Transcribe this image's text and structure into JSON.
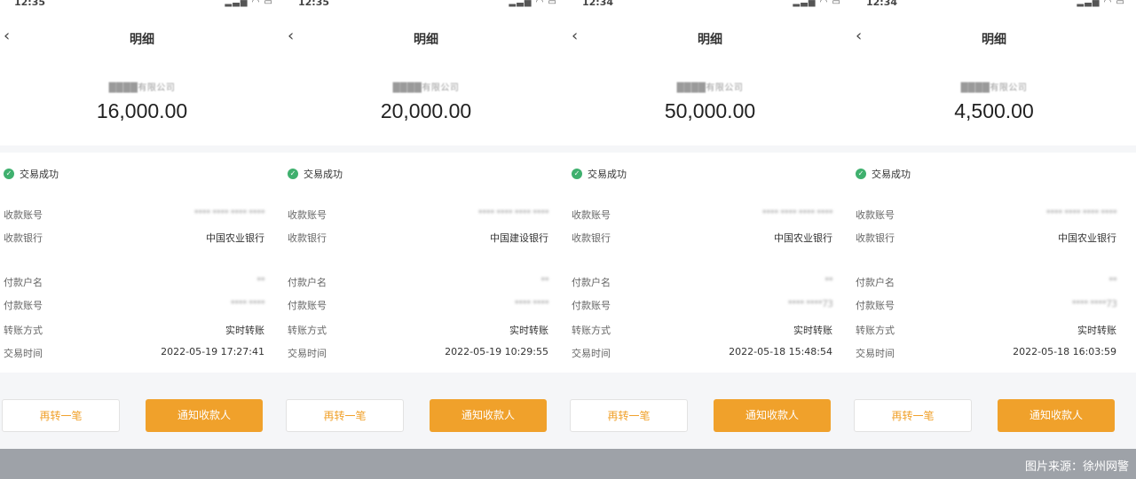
{
  "nav_title": "明细",
  "status_text": "交易成功",
  "labels": {
    "receiver_account": "收款账号",
    "receiver_bank": "收款银行",
    "payer_name": "付款户名",
    "payer_account": "付款账号",
    "transfer_method": "转账方式",
    "trade_time": "交易时间"
  },
  "buttons": {
    "again": "再转一笔",
    "notify": "通知收款人"
  },
  "screens": [
    {
      "time": "12:35",
      "company": "████有限公司",
      "amount": "16,000.00",
      "receiver_account": "**** **** **** ****",
      "receiver_bank": "中国农业银行",
      "payer_name": "**",
      "payer_account": "**** ****",
      "transfer_method": "实时转账",
      "trade_time": "2022-05-19 17:27:41"
    },
    {
      "time": "12:35",
      "company": "████有限公司",
      "amount": "20,000.00",
      "receiver_account": "**** **** **** ****",
      "receiver_bank": "中国建设银行",
      "payer_name": "**",
      "payer_account": "**** ****",
      "transfer_method": "实时转账",
      "trade_time": "2022-05-19 10:29:55"
    },
    {
      "time": "12:34",
      "company": "████有限公司",
      "amount": "50,000.00",
      "receiver_account": "**** **** **** ****",
      "receiver_bank": "中国农业银行",
      "payer_name": "**",
      "payer_account": "**** ****73",
      "transfer_method": "实时转账",
      "trade_time": "2022-05-18 15:48:54"
    },
    {
      "time": "12:34",
      "company": "████有限公司",
      "amount": "4,500.00",
      "receiver_account": "**** **** **** ****",
      "receiver_bank": "中国农业银行",
      "payer_name": "**",
      "payer_account": "**** ****73",
      "transfer_method": "实时转账",
      "trade_time": "2022-05-18 16:03:59"
    }
  ],
  "footer_credit": "图片来源：徐州网警",
  "colors": {
    "accent": "#f0a12b",
    "success": "#3fb06e",
    "footer": "#9ea2a8"
  },
  "icons": [
    "back-icon",
    "signal-icon",
    "wifi-icon",
    "battery-icon",
    "check-circle-icon"
  ]
}
